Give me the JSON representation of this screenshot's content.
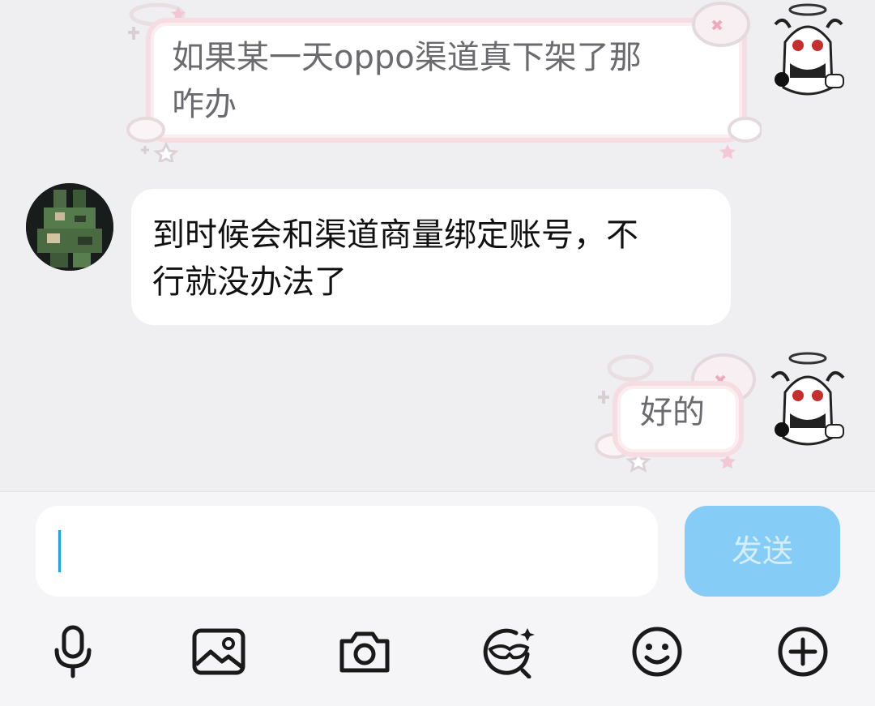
{
  "messages": [
    {
      "sender": "self",
      "text_line1": "如果某一天oppo渠道真下架了那",
      "text_line2": "咋办"
    },
    {
      "sender": "other",
      "text_line1": "到时候会和渠道商量绑定账号，不",
      "text_line2": "行就没办法了"
    },
    {
      "sender": "self",
      "text_line1": "好的"
    }
  ],
  "composer": {
    "input_value": "",
    "send_label": "发送"
  },
  "toolbar": {
    "icons": [
      "microphone-icon",
      "image-icon",
      "camera-icon",
      "sticker-icon",
      "emoji-icon",
      "plus-icon"
    ]
  },
  "colors": {
    "chat_background": "#efeff1",
    "bubble_background": "#ffffff",
    "send_button": "#85cdf7",
    "caret": "#1aa3e8",
    "deco_border": "#f6dde3"
  }
}
